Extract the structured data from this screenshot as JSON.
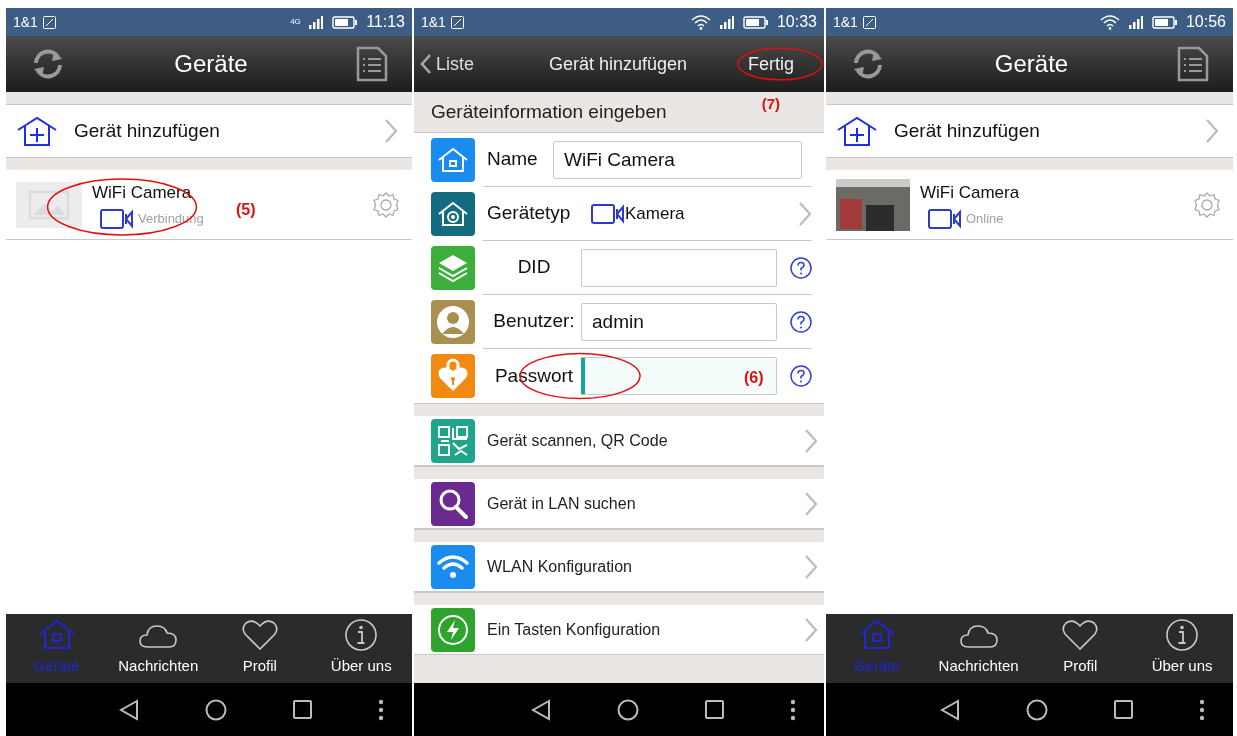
{
  "screens": [
    {
      "kind": "device_list",
      "status_bar": {
        "carrier": "1&1",
        "network": "4G",
        "time": "11:13"
      },
      "title": "Geräte",
      "add_device": "Gerät hinzufügen",
      "devices": [
        {
          "name": "WiFi Camera",
          "status": "Verbindung",
          "live_preview": false,
          "annotation": "(5)"
        }
      ],
      "tabs": [
        {
          "label": "Geräte",
          "selected": true
        },
        {
          "label": "Nachrichten",
          "selected": false
        },
        {
          "label": "Profil",
          "selected": false
        },
        {
          "label": "Über uns",
          "selected": false
        }
      ]
    },
    {
      "kind": "add_device",
      "status_bar": {
        "carrier": "1&1",
        "time": "10:33"
      },
      "back": "Liste",
      "title": "Gerät hinzufügen",
      "done": {
        "label": "Fertig",
        "annotation": "(7)"
      },
      "section": "Geräteinformation eingeben",
      "fields": [
        {
          "kind": "input",
          "label": "Name",
          "value": "WiFi Camera",
          "help": false,
          "focused": false
        },
        {
          "kind": "select",
          "label": "Gerätetyp",
          "value": "Kamera"
        },
        {
          "kind": "input",
          "label": "DID",
          "help": true,
          "focused": false
        },
        {
          "kind": "input",
          "label": "Benutzer:",
          "value": "admin",
          "help": true,
          "focused": false
        },
        {
          "kind": "input",
          "label": "Passwort",
          "help": true,
          "focused": true,
          "annotation": "(6)"
        }
      ],
      "actions": [
        "Gerät scannen, QR Code",
        "Gerät in LAN suchen",
        "WLAN Konfiguration",
        "Ein Tasten Konfiguration"
      ]
    },
    {
      "kind": "device_list",
      "status_bar": {
        "carrier": "1&1",
        "time": "10:56"
      },
      "title": "Geräte",
      "add_device": "Gerät hinzufügen",
      "devices": [
        {
          "name": "WiFi Camera",
          "status": "Online",
          "live_preview": true
        }
      ],
      "tabs": [
        {
          "label": "Geräte",
          "selected": true
        },
        {
          "label": "Nachrichten",
          "selected": false
        },
        {
          "label": "Profil",
          "selected": false
        },
        {
          "label": "Über uns",
          "selected": false
        }
      ]
    }
  ]
}
